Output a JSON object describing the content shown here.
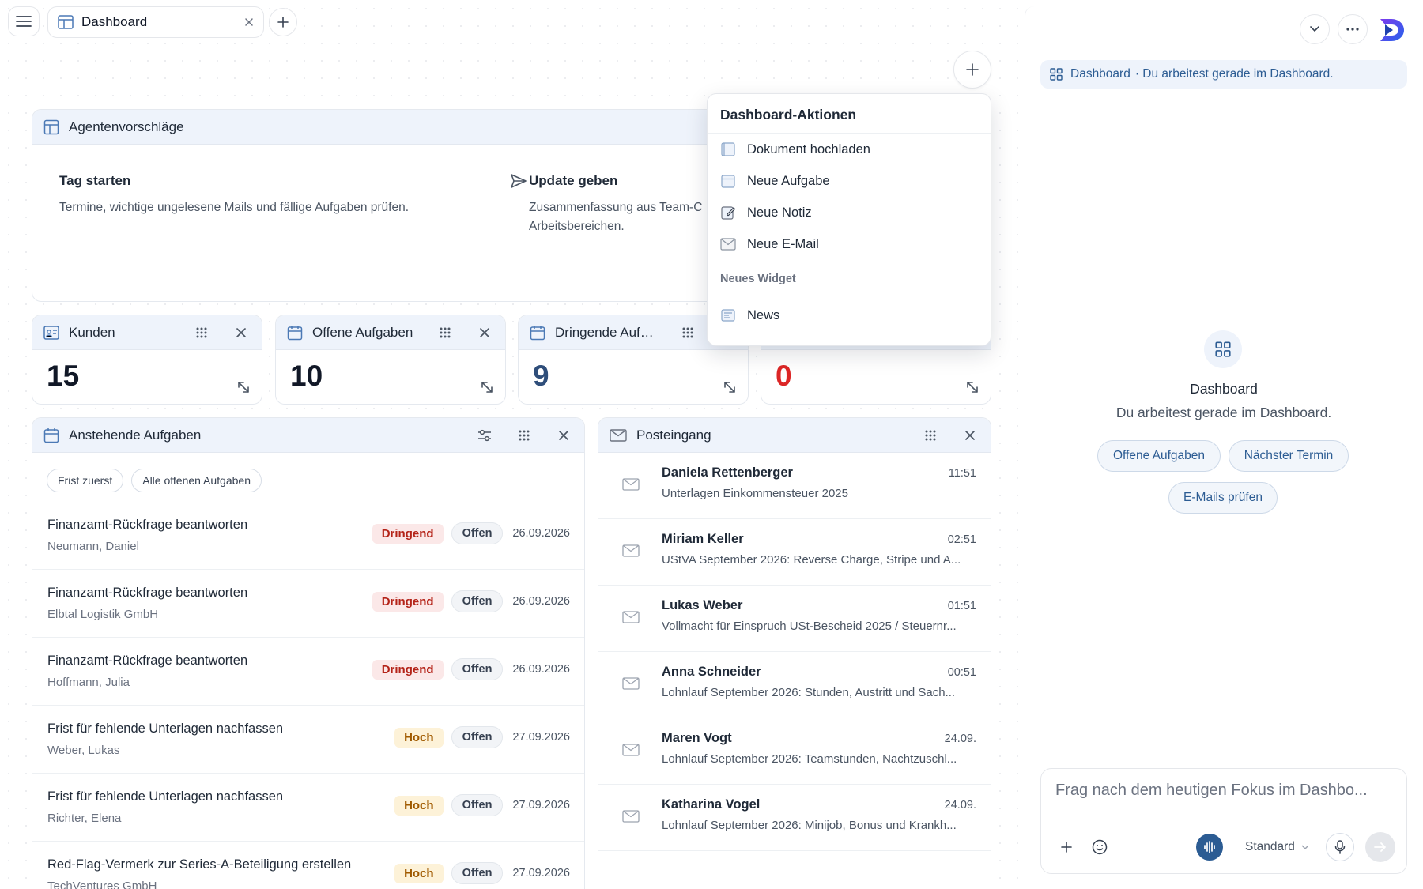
{
  "tabbar": {
    "tab_label": "Dashboard"
  },
  "agent": {
    "title": "Agentenvorschläge",
    "suggestions": [
      {
        "title": "Tag starten",
        "desc": "Termine, wichtige ungelesene Mails und fällige Aufgaben prüfen."
      },
      {
        "title": "Update geben",
        "desc_line1": "Zusammenfassung aus Team-C",
        "desc_line2": "Arbeitsbereichen."
      }
    ]
  },
  "stats": [
    {
      "title": "Kunden",
      "value": "15",
      "color": "#111827"
    },
    {
      "title": "Offene Aufgaben",
      "value": "10",
      "color": "#111827"
    },
    {
      "title": "Dringende Aufga...",
      "value": "9",
      "color": "#2f4e7a"
    },
    {
      "title": "",
      "value": "0",
      "color": "#dc2626"
    }
  ],
  "tasks": {
    "title": "Anstehende Aufgaben",
    "chips": [
      "Frist zuerst",
      "Alle offenen Aufgaben"
    ],
    "rows": [
      {
        "title": "Finanzamt-Rückfrage beantworten",
        "client": "Neumann, Daniel",
        "priority": "Dringend",
        "status": "Offen",
        "due": "26.09.2026"
      },
      {
        "title": "Finanzamt-Rückfrage beantworten",
        "client": "Elbtal Logistik GmbH",
        "priority": "Dringend",
        "status": "Offen",
        "due": "26.09.2026"
      },
      {
        "title": "Finanzamt-Rückfrage beantworten",
        "client": "Hoffmann, Julia",
        "priority": "Dringend",
        "status": "Offen",
        "due": "26.09.2026"
      },
      {
        "title": "Frist für fehlende Unterlagen nachfassen",
        "client": "Weber, Lukas",
        "priority": "Hoch",
        "status": "Offen",
        "due": "27.09.2026"
      },
      {
        "title": "Frist für fehlende Unterlagen nachfassen",
        "client": "Richter, Elena",
        "priority": "Hoch",
        "status": "Offen",
        "due": "27.09.2026"
      },
      {
        "title": "Red-Flag-Vermerk zur Series-A-Beteiligung erstellen",
        "client": "TechVentures GmbH",
        "priority": "Hoch",
        "status": "Offen",
        "due": "27.09.2026"
      }
    ]
  },
  "inbox": {
    "title": "Posteingang",
    "mails": [
      {
        "sender": "Daniela Rettenberger",
        "subject": "Unterlagen Einkommensteuer 2025",
        "time": "11:51"
      },
      {
        "sender": "Miriam Keller",
        "subject": "UStVA September 2026: Reverse Charge, Stripe und A...",
        "time": "02:51"
      },
      {
        "sender": "Lukas Weber",
        "subject": "Vollmacht für Einspruch USt-Bescheid 2025 / Steuernr...",
        "time": "01:51"
      },
      {
        "sender": "Anna Schneider",
        "subject": "Lohnlauf September 2026: Stunden, Austritt und Sach...",
        "time": "00:51"
      },
      {
        "sender": "Maren Vogt",
        "subject": "Lohnlauf September 2026: Teamstunden, Nachtzuschl...",
        "time": "24.09."
      },
      {
        "sender": "Katharina Vogel",
        "subject": "Lohnlauf September 2026: Minijob, Bonus und Krankh...",
        "time": "24.09."
      }
    ]
  },
  "dropdown": {
    "title": "Dashboard-Aktionen",
    "items": [
      {
        "label": "Dokument hochladen",
        "icon": "document-icon"
      },
      {
        "label": "Neue Aufgabe",
        "icon": "calendar-icon"
      },
      {
        "label": "Neue Notiz",
        "icon": "note-icon"
      },
      {
        "label": "Neue E-Mail",
        "icon": "mail-icon"
      }
    ],
    "section_label": "Neues Widget",
    "widget_items": [
      {
        "label": "News",
        "icon": "news-icon"
      }
    ]
  },
  "panel": {
    "context_title": "Dashboard",
    "context_text": "· Du arbeitest gerade im Dashboard.",
    "center_title": "Dashboard",
    "center_sub": "Du arbeitest gerade im Dashboard.",
    "pills": [
      "Offene Aufgaben",
      "Nächster Termin",
      "E-Mails prüfen"
    ],
    "chat_placeholder": "Frag nach dem heutigen Fokus im Dashbo...",
    "mode_label": "Standard"
  },
  "colors": {
    "accent": "#2c5c93",
    "brand_purple": "#7c3aed",
    "brand_blue": "#2563eb"
  }
}
